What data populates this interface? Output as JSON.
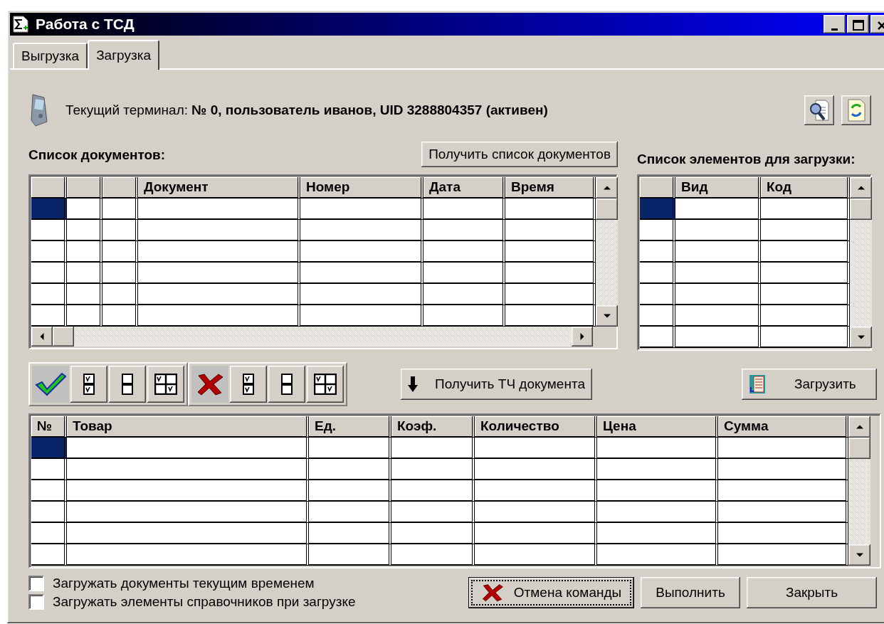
{
  "window": {
    "title": "Работа с ТСД"
  },
  "tabs": [
    {
      "label": "Выгрузка",
      "selected": false
    },
    {
      "label": "Загрузка",
      "selected": true
    }
  ],
  "terminal": {
    "label": "Текущий терминал: **№ 0, пользователь иванов, UID 3288804357 (активен)**"
  },
  "documents": {
    "title": "Список документов:",
    "fetch_button": "Получить список документов",
    "columns": [
      {
        "kind": "blank"
      },
      {
        "kind": "blank"
      },
      {
        "kind": "blank"
      },
      {
        "kind": "text",
        "label": "Документ"
      },
      {
        "kind": "text",
        "label": "Номер"
      },
      {
        "kind": "text",
        "label": "Дата"
      },
      {
        "kind": "text",
        "label": "Время"
      }
    ],
    "rows": [
      {
        "selected": true
      },
      {
        "selected": false
      },
      {
        "selected": false
      },
      {
        "selected": false
      },
      {
        "selected": false
      },
      {
        "selected": false
      }
    ]
  },
  "elements": {
    "title": "Список элементов для загрузки:",
    "columns": [
      {
        "kind": "blank"
      },
      {
        "kind": "text",
        "label": "Вид"
      },
      {
        "kind": "text",
        "label": "Код"
      }
    ],
    "rows": [
      {
        "selected": true
      },
      {
        "selected": false
      },
      {
        "selected": false
      },
      {
        "selected": false
      },
      {
        "selected": false
      },
      {
        "selected": false
      },
      {
        "selected": false
      }
    ]
  },
  "actions": {
    "get_lines_button": "Получить ТЧ документа",
    "load_button": "Загрузить"
  },
  "goods": {
    "columns": [
      {
        "kind": "text",
        "label": "№"
      },
      {
        "kind": "text",
        "label": "Товар"
      },
      {
        "kind": "text",
        "label": "Ед."
      },
      {
        "kind": "text",
        "label": "Коэф."
      },
      {
        "kind": "text",
        "label": "Количество"
      },
      {
        "kind": "text",
        "label": "Цена"
      },
      {
        "kind": "text",
        "label": "Сумма"
      }
    ],
    "rows": [
      {
        "selected": true
      },
      {
        "selected": false
      },
      {
        "selected": false
      },
      {
        "selected": false
      },
      {
        "selected": false
      },
      {
        "selected": false
      }
    ]
  },
  "options": [
    {
      "label": "Загружать документы текущим временем",
      "checked": false
    },
    {
      "label": "Загружать элементы справочников при загрузке",
      "checked": false
    }
  ],
  "buttons": [
    {
      "label": "Отмена команды",
      "kind": "cancel",
      "focused": true
    },
    {
      "label": "Выполнить",
      "kind": "plain",
      "focused": false
    },
    {
      "label": "Закрыть",
      "kind": "plain",
      "focused": false
    }
  ]
}
